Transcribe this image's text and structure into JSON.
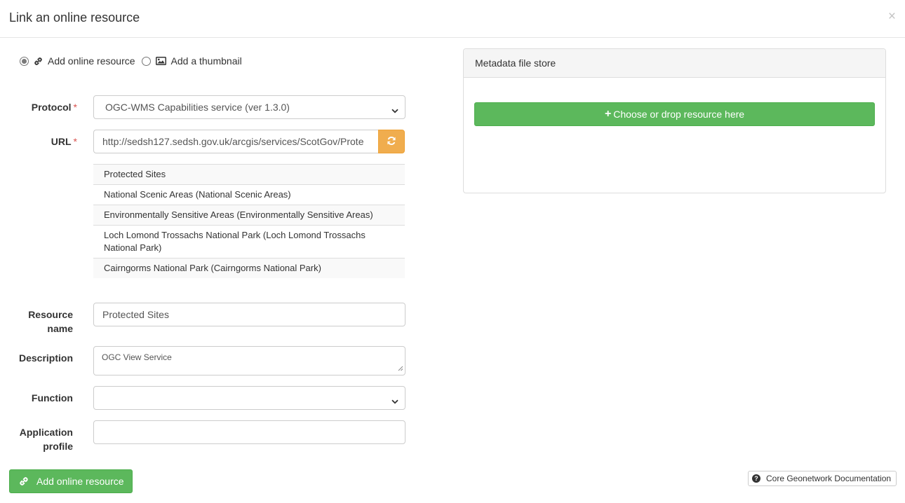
{
  "modal": {
    "title": "Link an online resource",
    "close_symbol": "×"
  },
  "mode": {
    "options": [
      {
        "label": "Add online resource",
        "icon": "link-icon",
        "selected": true
      },
      {
        "label": "Add a thumbnail",
        "icon": "image-icon",
        "selected": false
      }
    ]
  },
  "form": {
    "protocol": {
      "label": "Protocol",
      "required_mark": "*",
      "value": "OGC-WMS Capabilities service (ver 1.3.0)"
    },
    "url": {
      "label": "URL",
      "required_mark": "*",
      "value": "http://sedsh127.sedsh.gov.uk/arcgis/services/ScotGov/Prote"
    },
    "layers": [
      "Protected Sites",
      "National Scenic Areas (National Scenic Areas)",
      "Environmentally Sensitive Areas (Environmentally Sensitive Areas)",
      "Loch Lomond Trossachs National Park (Loch Lomond Trossachs National Park)",
      "Cairngorms National Park (Cairngorms National Park)"
    ],
    "resource_name": {
      "label_line1": "Resource",
      "label_line2": "name",
      "value": "Protected Sites"
    },
    "description": {
      "label": "Description",
      "value": "OGC View Service"
    },
    "function": {
      "label": "Function",
      "value": ""
    },
    "application_profile": {
      "label_line1": "Application",
      "label_line2": "profile",
      "value": ""
    },
    "submit_label": "Add online resource"
  },
  "file_store": {
    "heading": "Metadata file store",
    "drop_label": "Choose or drop resource here"
  },
  "docs_link": {
    "label": "Core Geonetwork Documentation"
  },
  "colors": {
    "primary_green": "#5cb85c",
    "warning_orange": "#f0ad4e",
    "required_red": "#d9534f"
  }
}
